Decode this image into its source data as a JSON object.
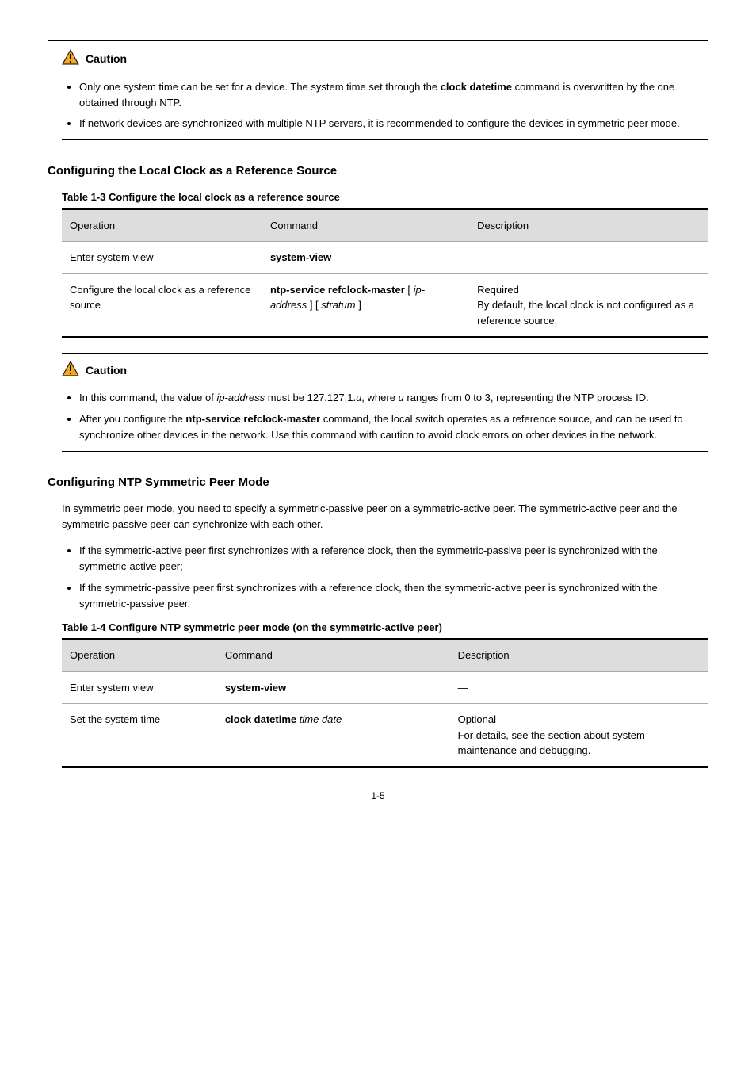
{
  "topRule": true,
  "caution1": {
    "label": "Caution",
    "items": [
      "Only one system time can be set for a device. The system time set through the <b>clock datetime</b> command is overwritten by the one obtained through NTP.",
      "If network devices are synchronized with multiple NTP servers, it is recommended to configure the devices in symmetric peer mode."
    ]
  },
  "section2": {
    "heading": "Configuring the Local Clock as a Reference Source",
    "tableCaption": "Table 1-3 Configure the local clock as a reference source",
    "columns": [
      "Operation",
      "Command",
      "Description"
    ],
    "rows": [
      [
        "Enter system view",
        "<b>system-view</b>",
        "—"
      ],
      [
        "Configure the local clock as a reference source",
        "<b>ntp-service refclock-master</b> [ <i>ip-address</i> ] [ <i>stratum</i> ]",
        "Required<br>By default, the local clock is not configured as a reference source."
      ]
    ]
  },
  "caution2": {
    "label": "Caution",
    "items": [
      "In this command, the value of <i>ip-address</i> must be 127.127.1.<i>u</i>, where <i>u</i> ranges from 0 to 3, representing the NTP process ID.",
      "After you configure the <b>ntp-service refclock-master</b> command, the local switch operates as a reference source, and can be used to synchronize other devices in the network. Use this command with caution to avoid clock errors on other devices in the network."
    ]
  },
  "section3": {
    "heading": "Configuring NTP Symmetric Peer Mode",
    "intro": "In symmetric peer mode, you need to specify a symmetric-passive peer on a symmetric-active peer. The symmetric-active peer and the symmetric-passive peer can synchronize with each other.",
    "bullets": [
      "If the symmetric-active peer first synchronizes with a reference clock, then the symmetric-passive peer is synchronized with the symmetric-active peer;",
      "If the symmetric-passive peer first synchronizes with a reference clock, then the symmetric-active peer is synchronized with the symmetric-passive peer."
    ],
    "tableCaption": "Table 1-4 Configure NTP symmetric peer mode (on the symmetric-active peer)",
    "columns": [
      "Operation",
      "Command",
      "Description"
    ],
    "rows": [
      [
        "Enter system view",
        "<b>system-view</b>",
        "—"
      ],
      [
        "Set the system time",
        "<b>clock datetime</b> <i>time date</i>",
        "Optional<br>For details, see the section about system maintenance and debugging."
      ]
    ]
  },
  "pageNumber": "1-5"
}
